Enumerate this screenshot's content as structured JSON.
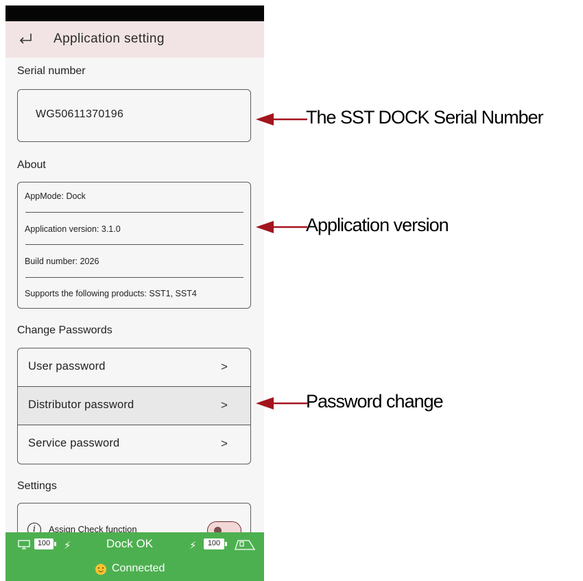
{
  "app": {
    "title": "Application setting"
  },
  "serial": {
    "section_label": "Serial number",
    "value": "WG50611370196"
  },
  "about": {
    "section_label": "About",
    "rows": [
      "AppMode: Dock",
      "Application version: 3.1.0",
      "Build number: 2026",
      "Supports the following products: SST1, SST4"
    ]
  },
  "passwords": {
    "section_label": "Change Passwords",
    "items": [
      {
        "label": "User password"
      },
      {
        "label": "Distributor password"
      },
      {
        "label": "Service password"
      }
    ],
    "chevron": ">"
  },
  "settings": {
    "section_label": "Settings",
    "item_label": "Assign Check function",
    "info_glyph": "i",
    "toggle_on": false
  },
  "footer": {
    "left_battery": "100",
    "status": "Dock OK",
    "right_battery": "100",
    "connection": "Connected",
    "color": "#4db050"
  },
  "annotations": [
    {
      "text": "The SST DOCK Serial Number"
    },
    {
      "text": "Application version"
    },
    {
      "text": "Password change"
    }
  ],
  "colors": {
    "accent_arrow": "#a3141e",
    "appbar": "#f2e4e4"
  },
  "icons": [
    "back-arrow-icon",
    "chevron-right-icon",
    "info-icon",
    "monitor-icon",
    "bolt-icon",
    "battery-icon",
    "dock-icon",
    "smiley-icon"
  ]
}
